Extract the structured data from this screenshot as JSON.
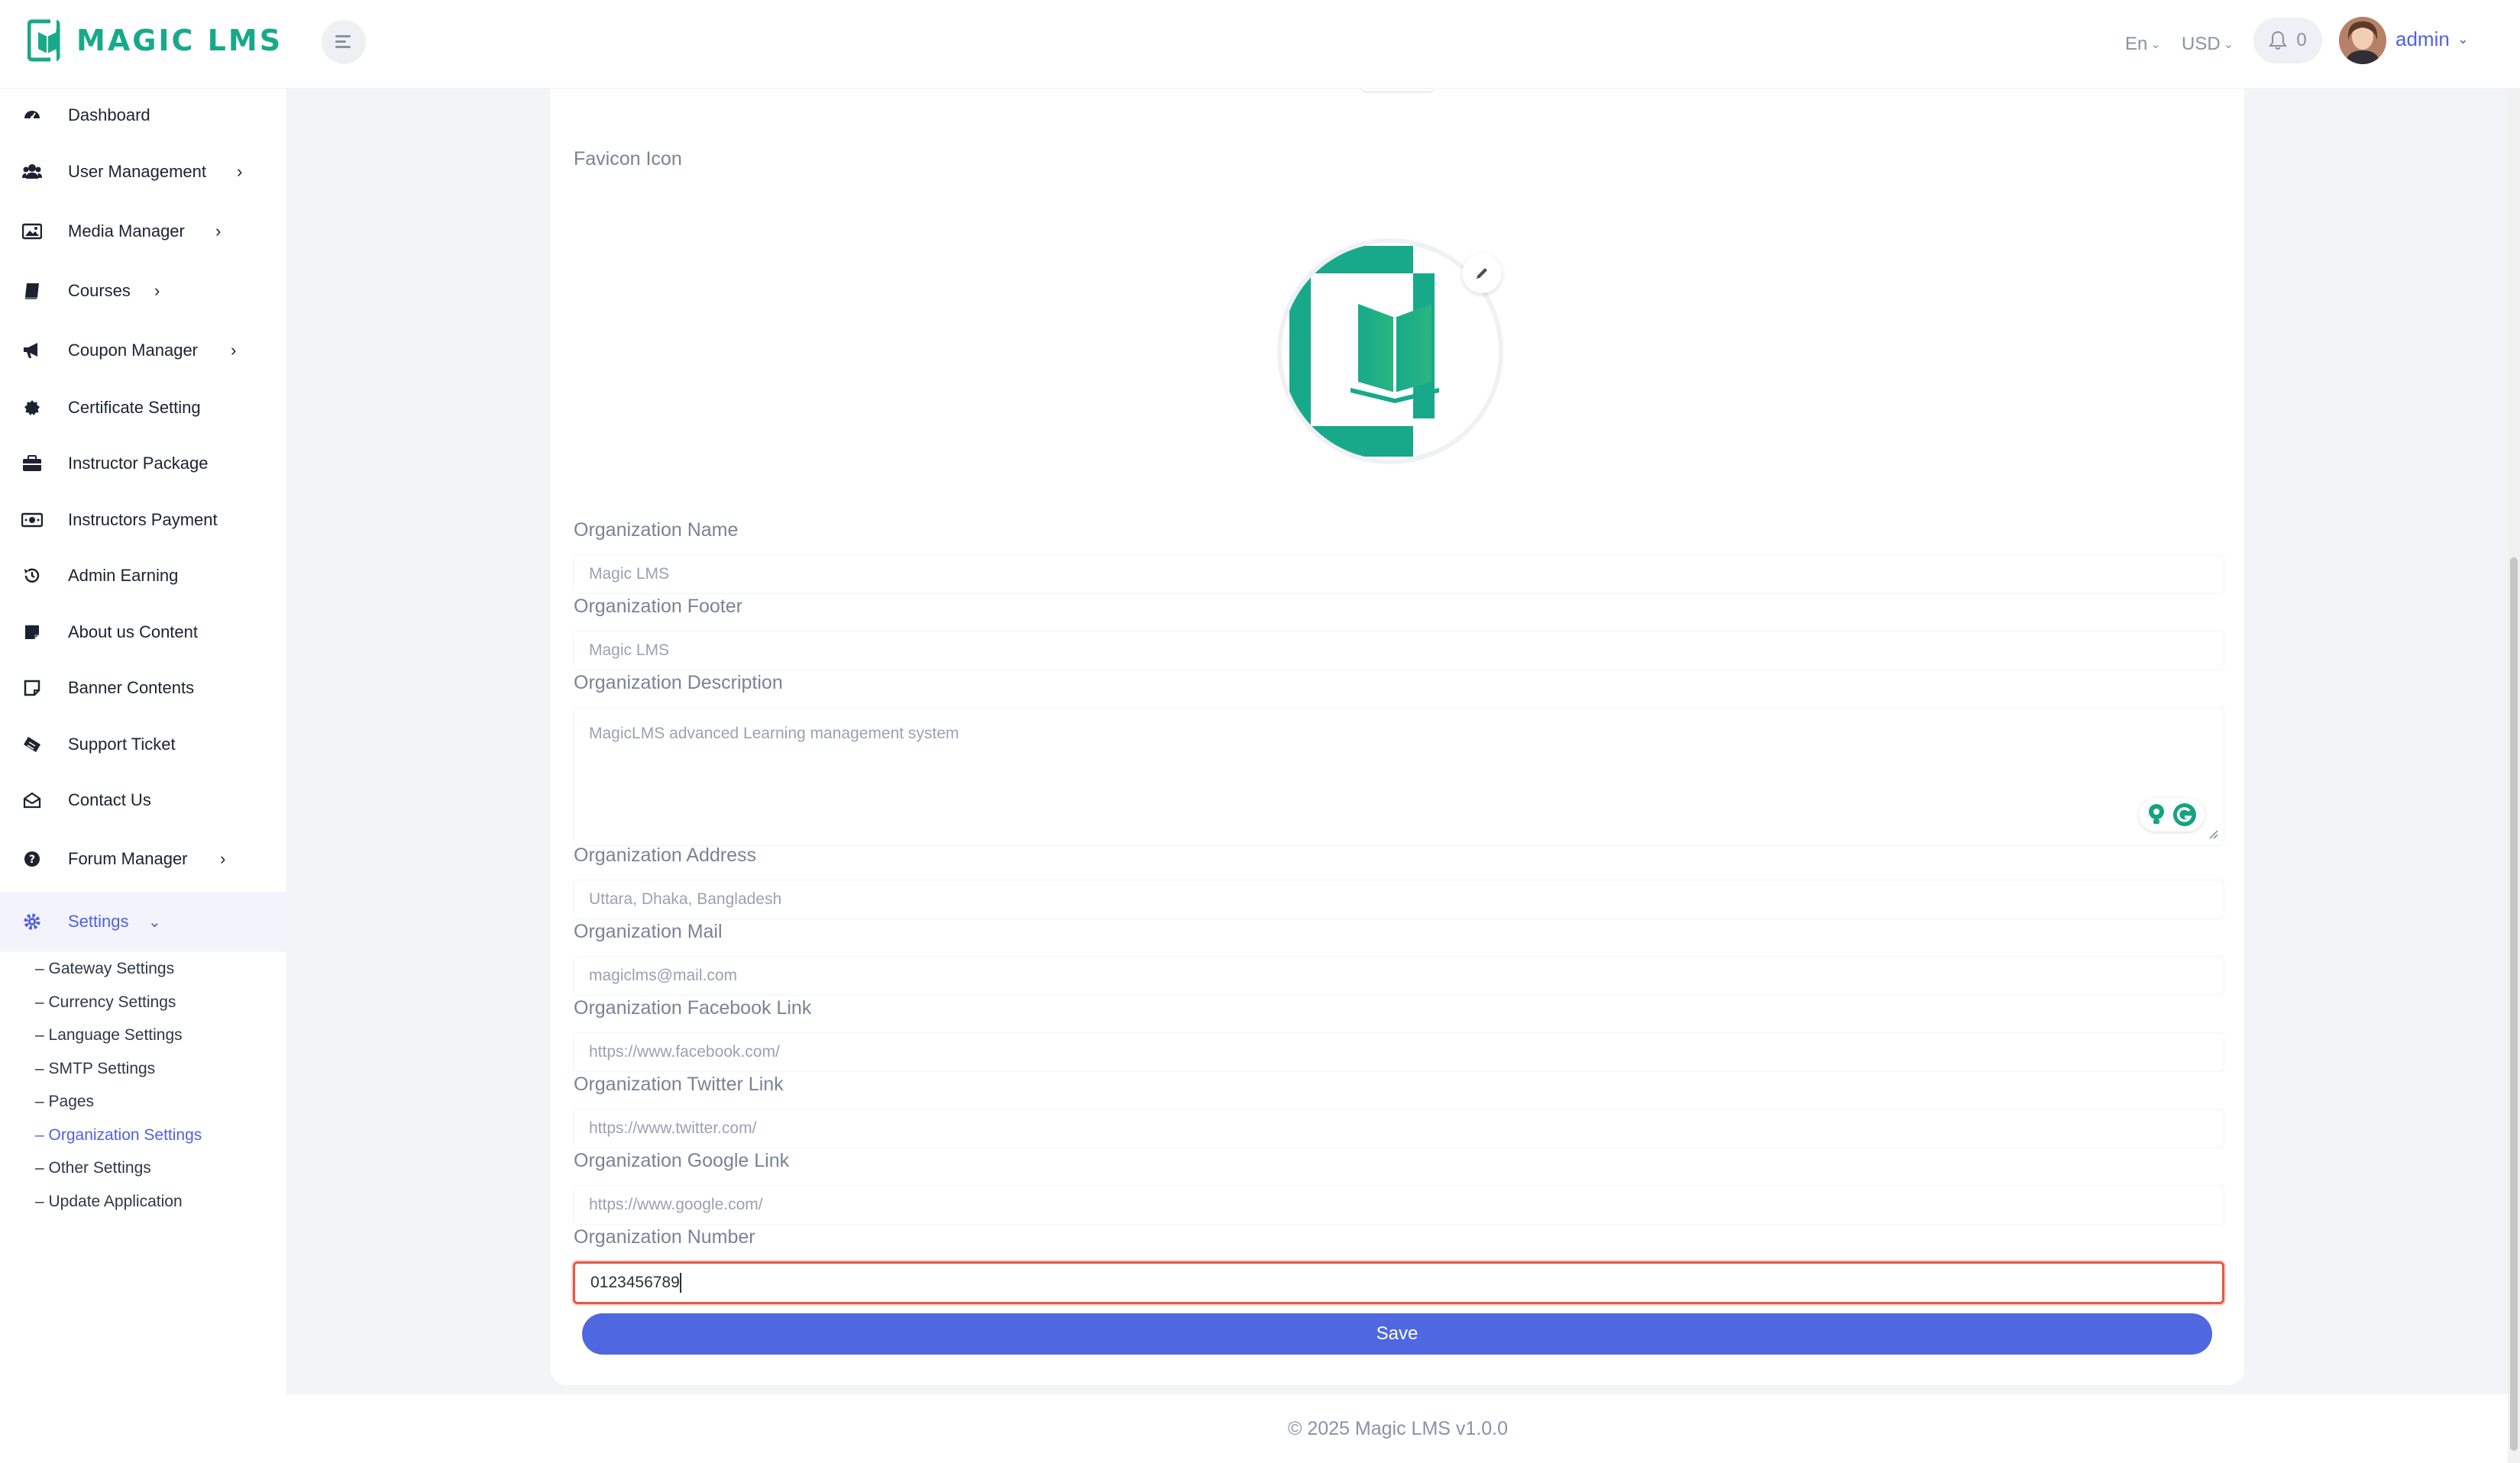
{
  "app": {
    "logo_text": "MAGIC LMS",
    "brand_color": "#17a98a",
    "accent_color": "#5160e0"
  },
  "header": {
    "language": "En",
    "currency": "USD",
    "notification_count": "0",
    "username": "admin"
  },
  "sidebar": {
    "items": [
      {
        "label": "Dashboard",
        "icon": "dashboard-icon"
      },
      {
        "label": "User Management",
        "icon": "users-icon"
      },
      {
        "label": "Media Manager",
        "icon": "image-icon"
      },
      {
        "label": "Courses",
        "icon": "book-icon"
      },
      {
        "label": "Coupon Manager",
        "icon": "megaphone-icon"
      },
      {
        "label": "Certificate Setting",
        "icon": "certificate-icon"
      },
      {
        "label": "Instructor Package",
        "icon": "briefcase-icon"
      },
      {
        "label": "Instructors Payment",
        "icon": "money-icon"
      },
      {
        "label": "Admin Earning",
        "icon": "history-icon"
      },
      {
        "label": "About us Content",
        "icon": "note-icon"
      },
      {
        "label": "Banner Contents",
        "icon": "sticky-note-icon"
      },
      {
        "label": "Support Ticket",
        "icon": "ticket-icon"
      },
      {
        "label": "Contact Us",
        "icon": "envelope-open-icon"
      },
      {
        "label": "Forum Manager",
        "icon": "question-icon"
      },
      {
        "label": "Settings",
        "icon": "gear-icon"
      }
    ],
    "settings_sub": [
      "– Gateway Settings",
      "– Currency Settings",
      "– Language Settings",
      "– SMTP Settings",
      "– Pages",
      "– Organization Settings",
      "– Other Settings",
      "– Update Application"
    ]
  },
  "form": {
    "favicon_label": "Favicon Icon",
    "org_name_label": "Organization Name",
    "org_name_placeholder": "Magic LMS",
    "org_footer_label": "Organization Footer",
    "org_footer_placeholder": "Magic LMS",
    "org_description_label": "Organization Description",
    "org_description_placeholder": "MagicLMS advanced Learning management system",
    "org_address_label": "Organization Address",
    "org_address_placeholder": "Uttara, Dhaka, Bangladesh",
    "org_mail_label": "Organization Mail",
    "org_mail_placeholder": "magiclms@mail.com",
    "org_facebook_label": "Organization Facebook Link",
    "org_facebook_placeholder": "https://www.facebook.com/",
    "org_twitter_label": "Organization Twitter Link",
    "org_twitter_placeholder": "https://www.twitter.com/",
    "org_google_label": "Organization Google Link",
    "org_google_placeholder": "https://www.google.com/",
    "org_number_label": "Organization Number",
    "org_number_value": "0123456789",
    "save_label": "Save"
  },
  "footer": {
    "copyright": "© 2025 Magic LMS v1.0.0"
  }
}
